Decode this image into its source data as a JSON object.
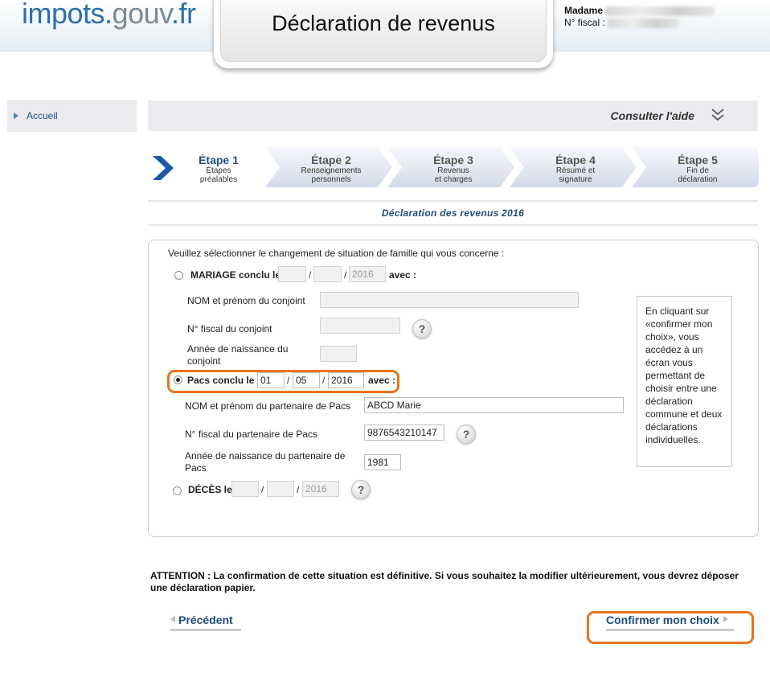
{
  "header": {
    "logo_part1": "impots.",
    "logo_part2": "gouv",
    "logo_part3": ".fr",
    "page_title": "Déclaration de revenus",
    "user_title_label": "Madame",
    "fiscal_number_label": "N° fiscal :"
  },
  "sidebar": {
    "items": [
      {
        "label": "Accueil",
        "icon": "triangle-right-icon"
      }
    ]
  },
  "help": {
    "label": "Consulter l'aide",
    "icon": "double-chevron-down-icon"
  },
  "steps": [
    {
      "title": "Étape 1",
      "line1": "Étapes",
      "line2": "préalables",
      "active": true
    },
    {
      "title": "Étape 2",
      "line1": "Renseignements",
      "line2": "personnels",
      "active": false
    },
    {
      "title": "Étape 3",
      "line1": "Revenus",
      "line2": "et charges",
      "active": false
    },
    {
      "title": "Étape 4",
      "line1": "Résumé et",
      "line2": "signature",
      "active": false
    },
    {
      "title": "Étape 5",
      "line1": "Fin de",
      "line2": "déclaration",
      "active": false
    }
  ],
  "declaration_title": "Déclaration des revenus 2016",
  "form": {
    "intro": "Veuillez sélectionner le changement de situation de famille qui vous concerne :",
    "mariage": {
      "label": "MARIAGE conclu le",
      "avec": "avec :",
      "day": "",
      "month": "",
      "year": "2016",
      "selected": false,
      "nom_label": "NOM et prénom du conjoint",
      "nom_value": "",
      "fiscal_label": "N° fiscal du conjoint",
      "fiscal_value": "",
      "naissance_label_1": "Année de naissance du",
      "naissance_label_2": "conjoint",
      "naissance_value": ""
    },
    "pacs": {
      "label": "Pacs conclu le",
      "avec": "avec :",
      "day": "01",
      "month": "05",
      "year": "2016",
      "selected": true,
      "nom_label": "NOM et prénom du partenaire de Pacs",
      "nom_value": "ABCD Marie",
      "fiscal_label": "N° fiscal du partenaire de Pacs",
      "fiscal_value": "9876543210147",
      "naissance_label_1": "Année de naissance du partenaire de",
      "naissance_label_2": "Pacs",
      "naissance_value": "1981"
    },
    "deces": {
      "label": "DÉCÈS le",
      "day": "",
      "month": "",
      "year": "2016",
      "selected": false
    },
    "date_separator": "/",
    "help_glyph": "?"
  },
  "info_box": "En cliquant sur «confirmer mon choix», vous accédez à un écran vous permettant de choisir entre une déclaration commune et deux déclarations individuelles.",
  "warning": "ATTENTION : La confirmation de cette situation est définitive. Si vous souhaitez la modifier ultérieurement, vous devrez déposer une déclaration papier.",
  "nav": {
    "previous_label": "Précédent",
    "confirm_label": "Confirmer mon choix"
  },
  "colors": {
    "brand_blue": "#2d6fab",
    "link_blue": "#1f4a7a",
    "highlight_orange": "#e8741e",
    "step_bg": "#d7dcea"
  }
}
